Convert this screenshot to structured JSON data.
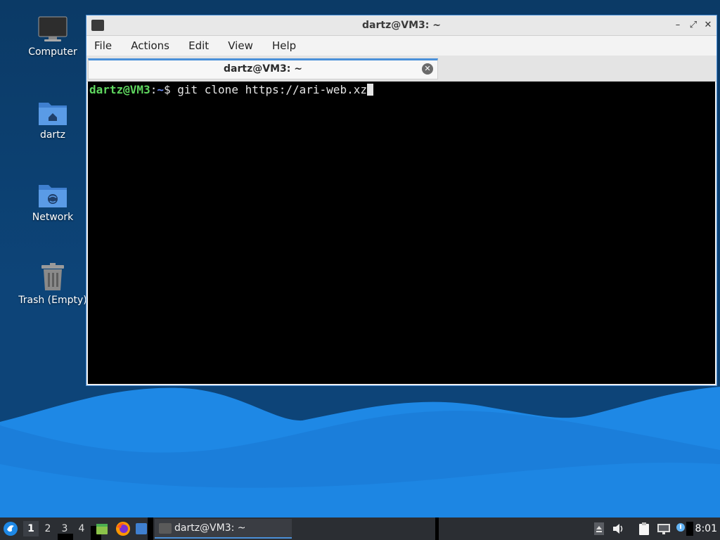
{
  "desktop_icons": [
    {
      "label": "Computer",
      "icon": "monitor-icon"
    },
    {
      "label": "dartz",
      "icon": "home-folder-icon"
    },
    {
      "label": "Network",
      "icon": "network-folder-icon"
    },
    {
      "label": "Trash (Empty)",
      "icon": "trash-icon"
    }
  ],
  "window": {
    "title": "dartz@VM3: ~",
    "controls": {
      "minimize": "–",
      "maximize": "⤢",
      "close": "✕"
    }
  },
  "menu": [
    "File",
    "Actions",
    "Edit",
    "View",
    "Help"
  ],
  "tab": {
    "label": "dartz@VM3: ~",
    "close": "✕"
  },
  "terminal": {
    "user_host": "dartz@VM3",
    "colon": ":",
    "path": "~",
    "prompt_symbol": "$ ",
    "command": "git clone https://ari-web.xz"
  },
  "taskbar": {
    "workspaces": [
      "1",
      "2",
      "3",
      "4"
    ],
    "active_workspace": "1",
    "task_label": "dartz@VM3: ~",
    "clock": "8:01"
  },
  "colors": {
    "accent": "#4a90d9",
    "prompt_user": "#5fd75f",
    "prompt_path": "#6c8cf5",
    "desktop_bg": "#0d4478"
  }
}
